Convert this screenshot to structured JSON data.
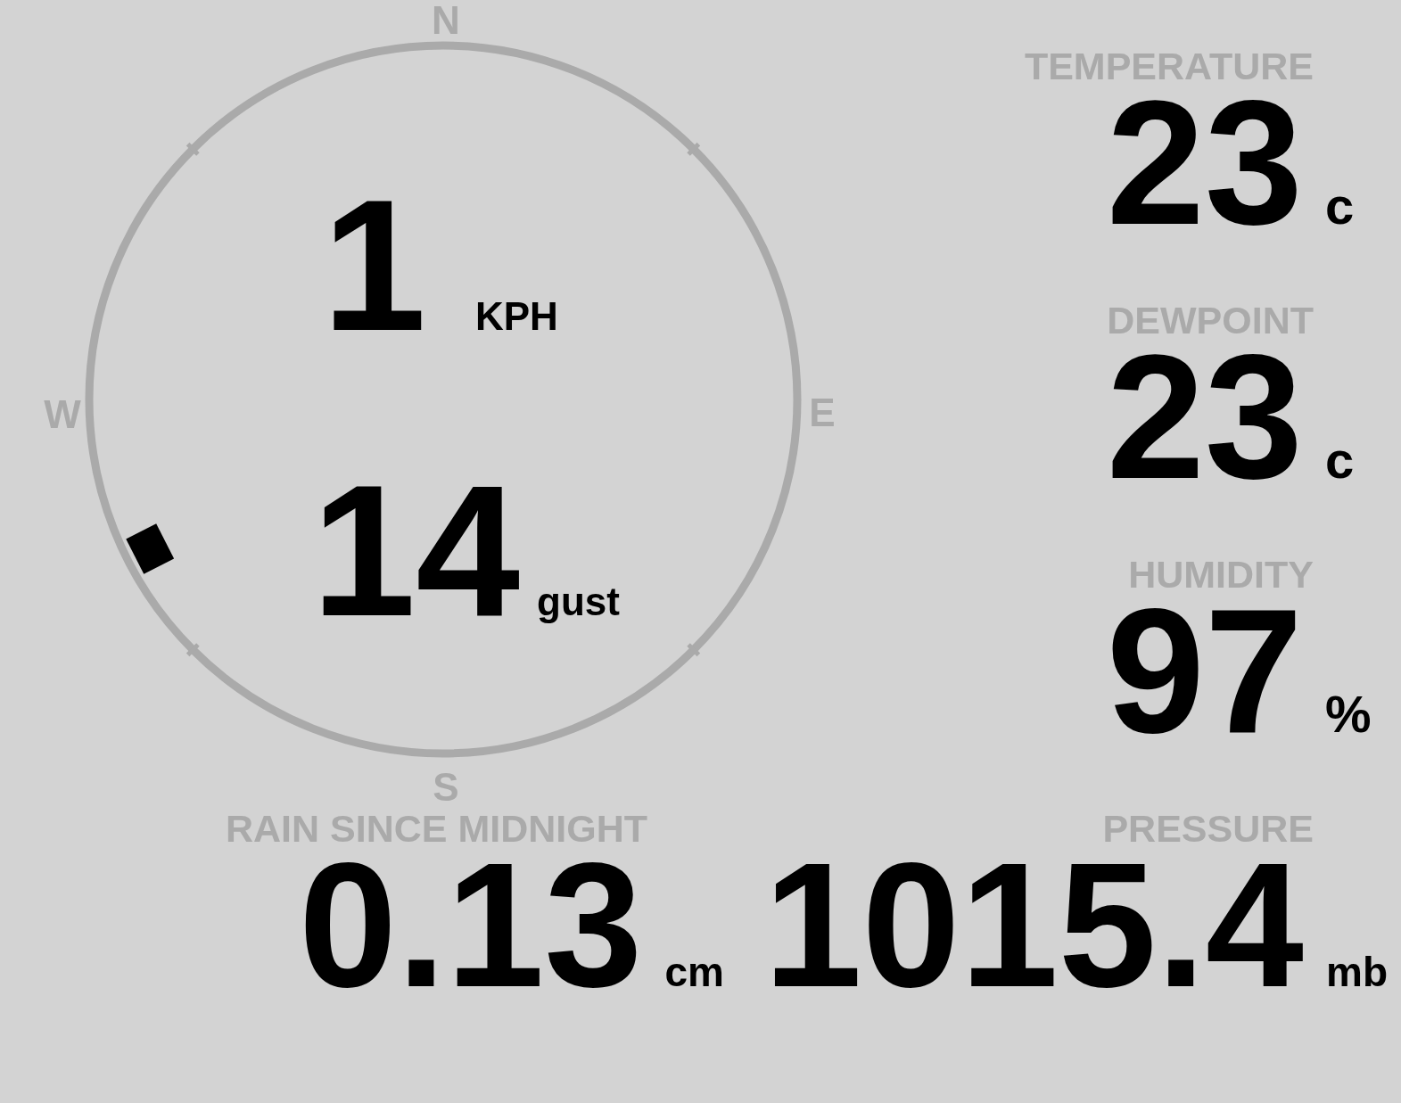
{
  "wind": {
    "compass": [
      "N",
      "E",
      "S",
      "W"
    ],
    "speed": "1",
    "speed_unit": "KPH",
    "gust": "14",
    "gust_unit": "gust"
  },
  "readings": [
    {
      "label": "TEMPERATURE",
      "value": "23",
      "unit": "c"
    },
    {
      "label": "DEWPOINT",
      "value": "23",
      "unit": "c"
    },
    {
      "label": "HUMIDITY",
      "value": "97",
      "unit": "%"
    }
  ],
  "rain": {
    "label": "RAIN SINCE MIDNIGHT",
    "value": "0.13",
    "unit": "cm"
  },
  "pressure": {
    "label": "PRESSURE",
    "value": "1015.4",
    "unit": "mb"
  }
}
